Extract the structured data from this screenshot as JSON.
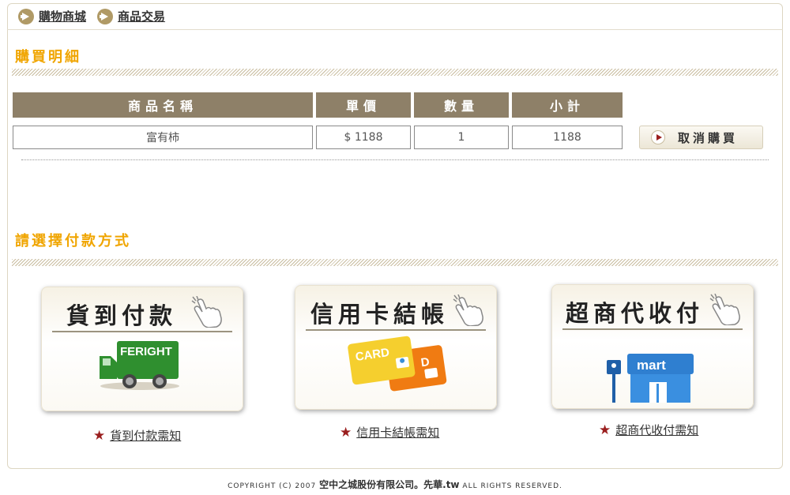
{
  "nav": {
    "links": [
      "購物商城",
      "商品交易"
    ]
  },
  "purchase": {
    "title": "購買明細",
    "headers": [
      "商品名稱",
      "單價",
      "數量",
      "小計"
    ],
    "row": {
      "name": "富有柿",
      "price": "$ 1188",
      "qty": "1",
      "subtotal": "1188"
    },
    "cancel_label": "取消購買"
  },
  "payment": {
    "title": "請選擇付款方式",
    "options": [
      {
        "title": "貨到付款",
        "icon": "freight-truck-icon",
        "truck_text": "FERIGHT",
        "link": "貨到付款需知"
      },
      {
        "title": "信用卡結帳",
        "icon": "credit-card-icon",
        "card_text": "CARD",
        "card_text_back": "D",
        "link": "信用卡結帳需知"
      },
      {
        "title": "超商代收付",
        "icon": "mart-store-icon",
        "mart_text": "mart",
        "link": "超商代收付需知"
      }
    ]
  },
  "footer": {
    "prefix": "COPYRIGHT (C) 2007",
    "company": "空中之城股份有限公司。先華.tw",
    "suffix": "ALL RIGHTS RESERVED."
  },
  "colors": {
    "accent_title": "#f0a500",
    "header_bg": "#8e8068",
    "star": "#9a1e1e"
  }
}
